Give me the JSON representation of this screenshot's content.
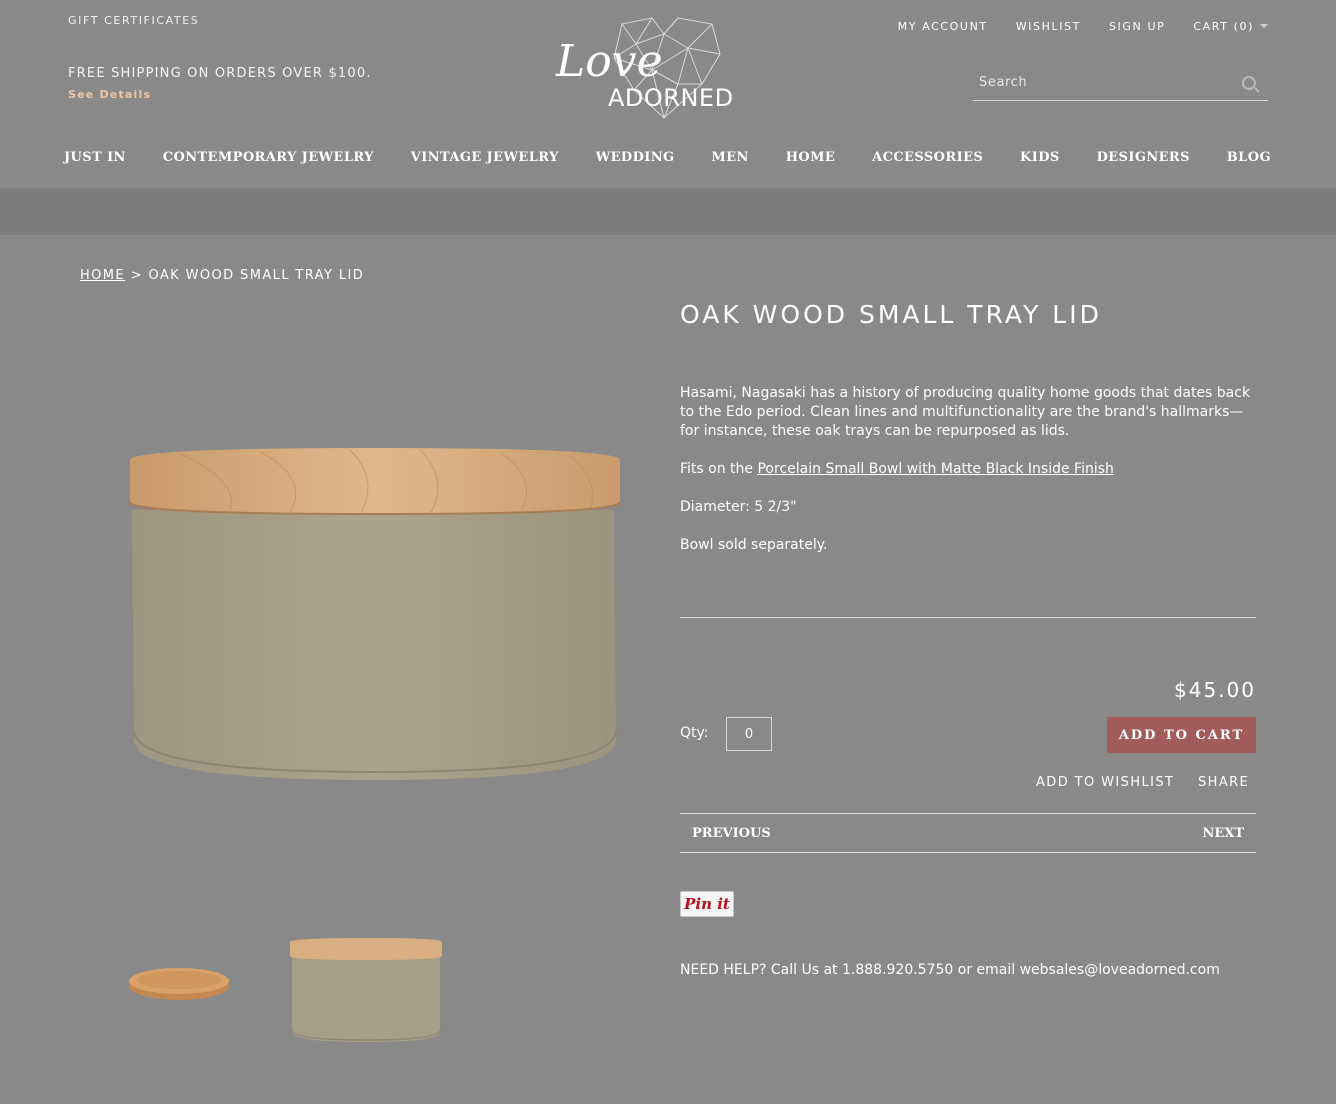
{
  "header": {
    "gift_certificates": "GIFT CERTIFICATES",
    "shipping_text": "FREE SHIPPING ON ORDERS OVER $100.",
    "see_details": "See Details",
    "logo_script": "Love",
    "logo_text": "ADORNED",
    "top_links": {
      "my_account": "MY ACCOUNT",
      "wishlist": "WISHLIST",
      "sign_up": "SIGN UP",
      "cart": "CART (0)"
    },
    "search_placeholder": "Search"
  },
  "nav": {
    "items": [
      "JUST IN",
      "CONTEMPORARY JEWELRY",
      "VINTAGE JEWELRY",
      "WEDDING",
      "MEN",
      "HOME",
      "ACCESSORIES",
      "KIDS",
      "DESIGNERS",
      "BLOG"
    ]
  },
  "breadcrumb": {
    "home": "HOME",
    "separator": ">",
    "current": "OAK WOOD SMALL TRAY LID"
  },
  "product": {
    "title": "OAK WOOD SMALL TRAY LID",
    "description": "Hasami, Nagasaki has a history of producing quality home goods that dates back to the Edo period. Clean lines and multifunctionality are the brand's hallmarks—for instance, these oak trays can be repurposed as lids.",
    "fits_prefix": "Fits on the ",
    "fits_link": "Porcelain Small Bowl with Matte Black Inside Finish",
    "diameter": "Diameter: 5 2/3\"",
    "note": "Bowl sold separately.",
    "price": "$45.00",
    "qty_label": "Qty:",
    "qty_value": "0",
    "add_to_cart": "ADD TO CART",
    "add_to_wishlist": "ADD TO WISHLIST",
    "share": "SHARE",
    "previous": "PREVIOUS",
    "next": "NEXT",
    "pin_it": "Pin it",
    "help": "NEED HELP? Call Us at 1.888.920.5750 or email websales@loveadorned.com"
  },
  "colors": {
    "background": "#898989",
    "band": "#7d7d7d",
    "add_to_cart": "#a35c5c",
    "see_details": "#f0c7a4",
    "pinit_red": "#b5121b"
  }
}
